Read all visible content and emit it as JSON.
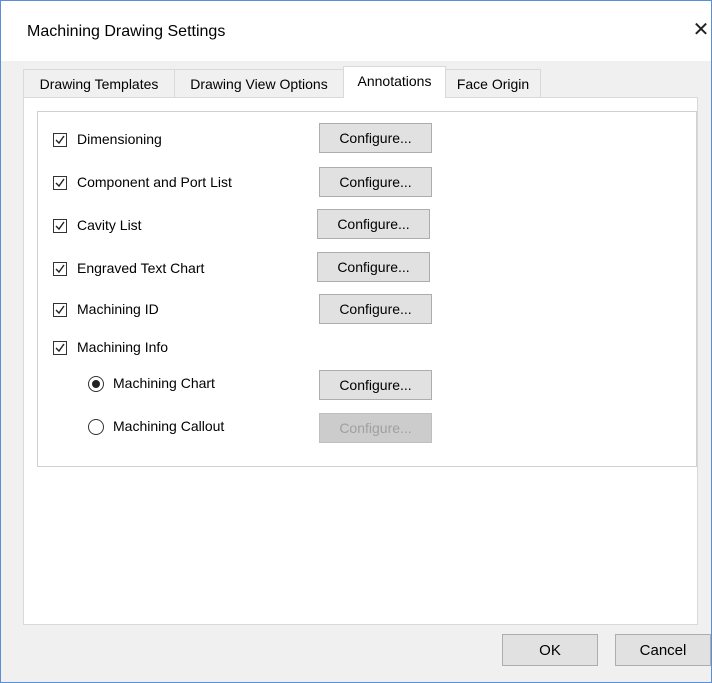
{
  "window": {
    "title": "Machining Drawing Settings",
    "close_glyph": "✕"
  },
  "tabs": [
    {
      "label": "Drawing Templates",
      "active": false
    },
    {
      "label": "Drawing View Options",
      "active": false
    },
    {
      "label": "Annotations",
      "active": true
    },
    {
      "label": "Face Origin",
      "active": false
    }
  ],
  "annotations": {
    "dimensioning": {
      "label": "Dimensioning",
      "checked": true,
      "button": "Configure..."
    },
    "component_port_list": {
      "label": "Component and Port List",
      "checked": true,
      "button": "Configure..."
    },
    "cavity_list": {
      "label": "Cavity List",
      "checked": true,
      "button": "Configure..."
    },
    "engraved_text_chart": {
      "label": "Engraved Text Chart",
      "checked": true,
      "button": "Configure..."
    },
    "machining_id": {
      "label": "Machining ID",
      "checked": true,
      "button": "Configure..."
    },
    "machining_info": {
      "label": "Machining Info",
      "checked": true
    },
    "machining_chart": {
      "label": "Machining Chart",
      "selected": true,
      "button": "Configure..."
    },
    "machining_callout": {
      "label": "Machining Callout",
      "selected": false,
      "button": "Configure...",
      "button_enabled": false
    }
  },
  "footer": {
    "ok_label": "OK",
    "cancel_label": "Cancel"
  }
}
